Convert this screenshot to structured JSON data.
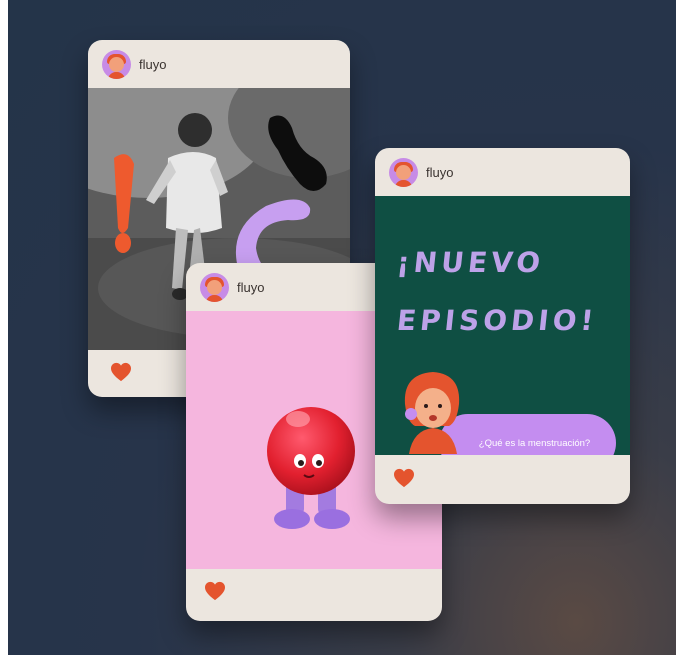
{
  "cards": [
    {
      "username": "fluyo",
      "avatar_icon": "avatar-icon",
      "image": "black-and-white photo of a child running with orange and lilac sticker overlays",
      "like_icon": "heart-icon"
    },
    {
      "username": "fluyo",
      "avatar_icon": "avatar-icon",
      "image": "red ball character with purple boots on pink background",
      "like_icon": "heart-icon"
    },
    {
      "username": "fluyo",
      "avatar_icon": "avatar-icon",
      "headline_line1": "¡NUEVO",
      "headline_line2": "EPISODIO!",
      "pill_text": "¿Qué es la menstruación?",
      "like_icon": "heart-icon"
    }
  ],
  "colors": {
    "background": "#243449",
    "card": "#ece6df",
    "heart": "#e4542e",
    "avatar_bg": "#c78be6",
    "pink_panel": "#f5b6de",
    "green_panel": "#0f4f43",
    "headline": "#bda2e8",
    "pill": "#c48df0"
  }
}
